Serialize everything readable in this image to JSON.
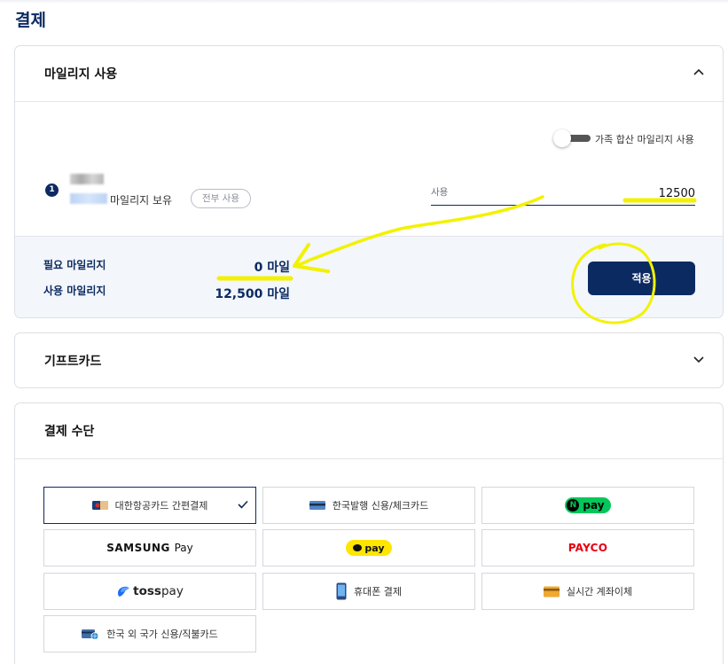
{
  "page": {
    "title": "결제"
  },
  "mileage": {
    "header": "마일리지 사용",
    "family_toggle_label": "가족 합산 마일리지 사용",
    "member_number": "1",
    "holding_label": "마일리지 보유",
    "use_all_label": "전부 사용",
    "use_field_label": "사용",
    "use_value": "12500",
    "required_label": "필요 마일리지",
    "required_value": "0 마일",
    "used_label": "사용 마일리지",
    "used_value": "12,500 마일",
    "apply_label": "적용"
  },
  "giftcard": {
    "header": "기프트카드"
  },
  "payment": {
    "header": "결제 수단",
    "methods": [
      {
        "label": "대한항공카드 간편결제",
        "icon": "card-icon"
      },
      {
        "label": "한국발행 신용/체크카드",
        "icon": "credit-card-icon"
      },
      {
        "label": "pay",
        "icon": "naver-pay-logo",
        "logo_letter": "N"
      },
      {
        "label": "SAMSUNG",
        "label2": "Pay",
        "icon": "samsung-pay-logo"
      },
      {
        "label": "pay",
        "icon": "kakao-pay-logo"
      },
      {
        "label": "PAYCO",
        "icon": "payco-logo"
      },
      {
        "label": "toss",
        "label2": "pay",
        "icon": "toss-pay-logo"
      },
      {
        "label": "휴대폰 결제",
        "icon": "phone-icon"
      },
      {
        "label": "실시간 계좌이체",
        "icon": "bank-card-icon"
      },
      {
        "label": "한국 외 국가 신용/직불카드",
        "icon": "global-card-icon"
      }
    ],
    "selected_index": 0
  },
  "colors": {
    "primary": "#0c2a62",
    "summary_bg": "#f3f6fb",
    "annotation": "#f2f200",
    "naver_green": "#03c75a",
    "kakao_yellow": "#ffe500",
    "payco_red": "#e60012"
  }
}
